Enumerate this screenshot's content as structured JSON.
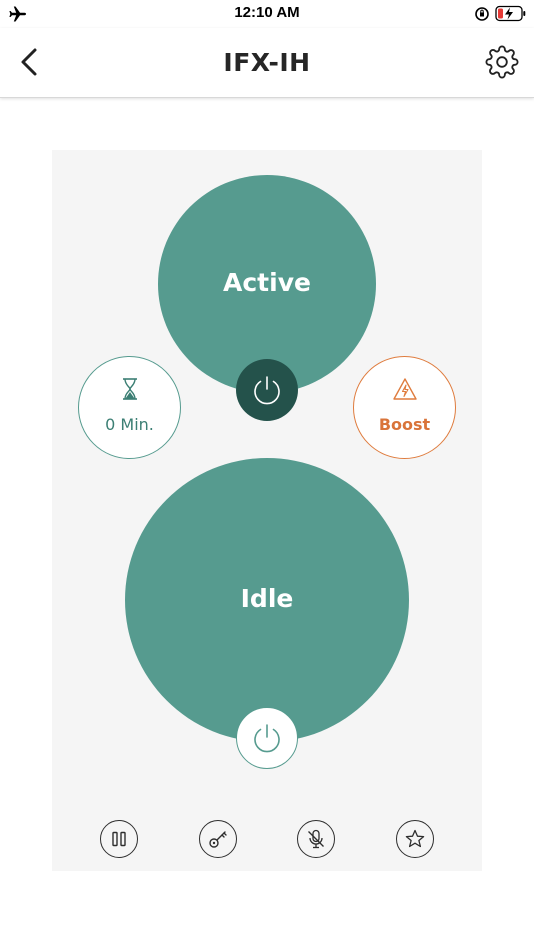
{
  "status_bar": {
    "time": "12:10 AM",
    "icons": [
      "airplane-icon",
      "orientation-lock-icon",
      "battery-charging-icon"
    ]
  },
  "nav": {
    "title": "IFX-IH",
    "back_icon": "chevron-left-icon",
    "settings_icon": "gear-icon"
  },
  "zones": [
    {
      "label": "Active",
      "power_icon": "power-icon"
    },
    {
      "label": "Idle",
      "power_icon": "power-icon"
    }
  ],
  "timer": {
    "label": "0 Min.",
    "icon": "hourglass-icon"
  },
  "boost": {
    "label": "Boost",
    "icon": "lightning-warning-icon"
  },
  "toolbar": {
    "items": [
      {
        "icon": "pause-icon"
      },
      {
        "icon": "key-icon"
      },
      {
        "icon": "microphone-off-icon"
      },
      {
        "icon": "star-icon"
      }
    ]
  },
  "colors": {
    "zone": "#569b8f",
    "power_active": "#24524b",
    "boost_accent": "#df7c3e",
    "panel_bg": "#f5f5f5"
  }
}
